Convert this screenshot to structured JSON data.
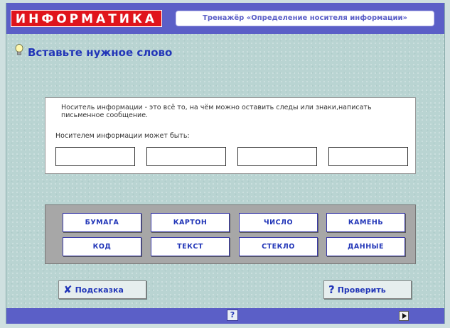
{
  "header": {
    "brand": "ИНФОРМАТИКА",
    "trainer_title": "Тренажёр «Определение носителя информации»"
  },
  "task": {
    "icon": "lightbulb-icon",
    "heading": "Вставьте нужное слово"
  },
  "question": {
    "text": "Носитель информации - это всё то, на чём можно оставить следы или знаки,написать письменное сообщение.",
    "label": "Носителем информации может быть:",
    "answer_slots": [
      "",
      "",
      "",
      ""
    ]
  },
  "word_bank": {
    "words": [
      "БУМАГА",
      "КАРТОН",
      "ЧИСЛО",
      "КАМЕНЬ",
      "КОД",
      "ТЕКСТ",
      "СТЕКЛО",
      "ДАННЫЕ"
    ]
  },
  "actions": {
    "hint_label": "Подсказка",
    "hint_icon": "x-icon",
    "check_label": "Проверить",
    "check_icon": "question-icon"
  },
  "footer": {
    "help_label": "?",
    "next_icon": "play-icon"
  },
  "colors": {
    "brand_red": "#e0141c",
    "bar_blue": "#5b5fc7",
    "text_blue": "#2236b8",
    "background": "#b9d4d2"
  }
}
